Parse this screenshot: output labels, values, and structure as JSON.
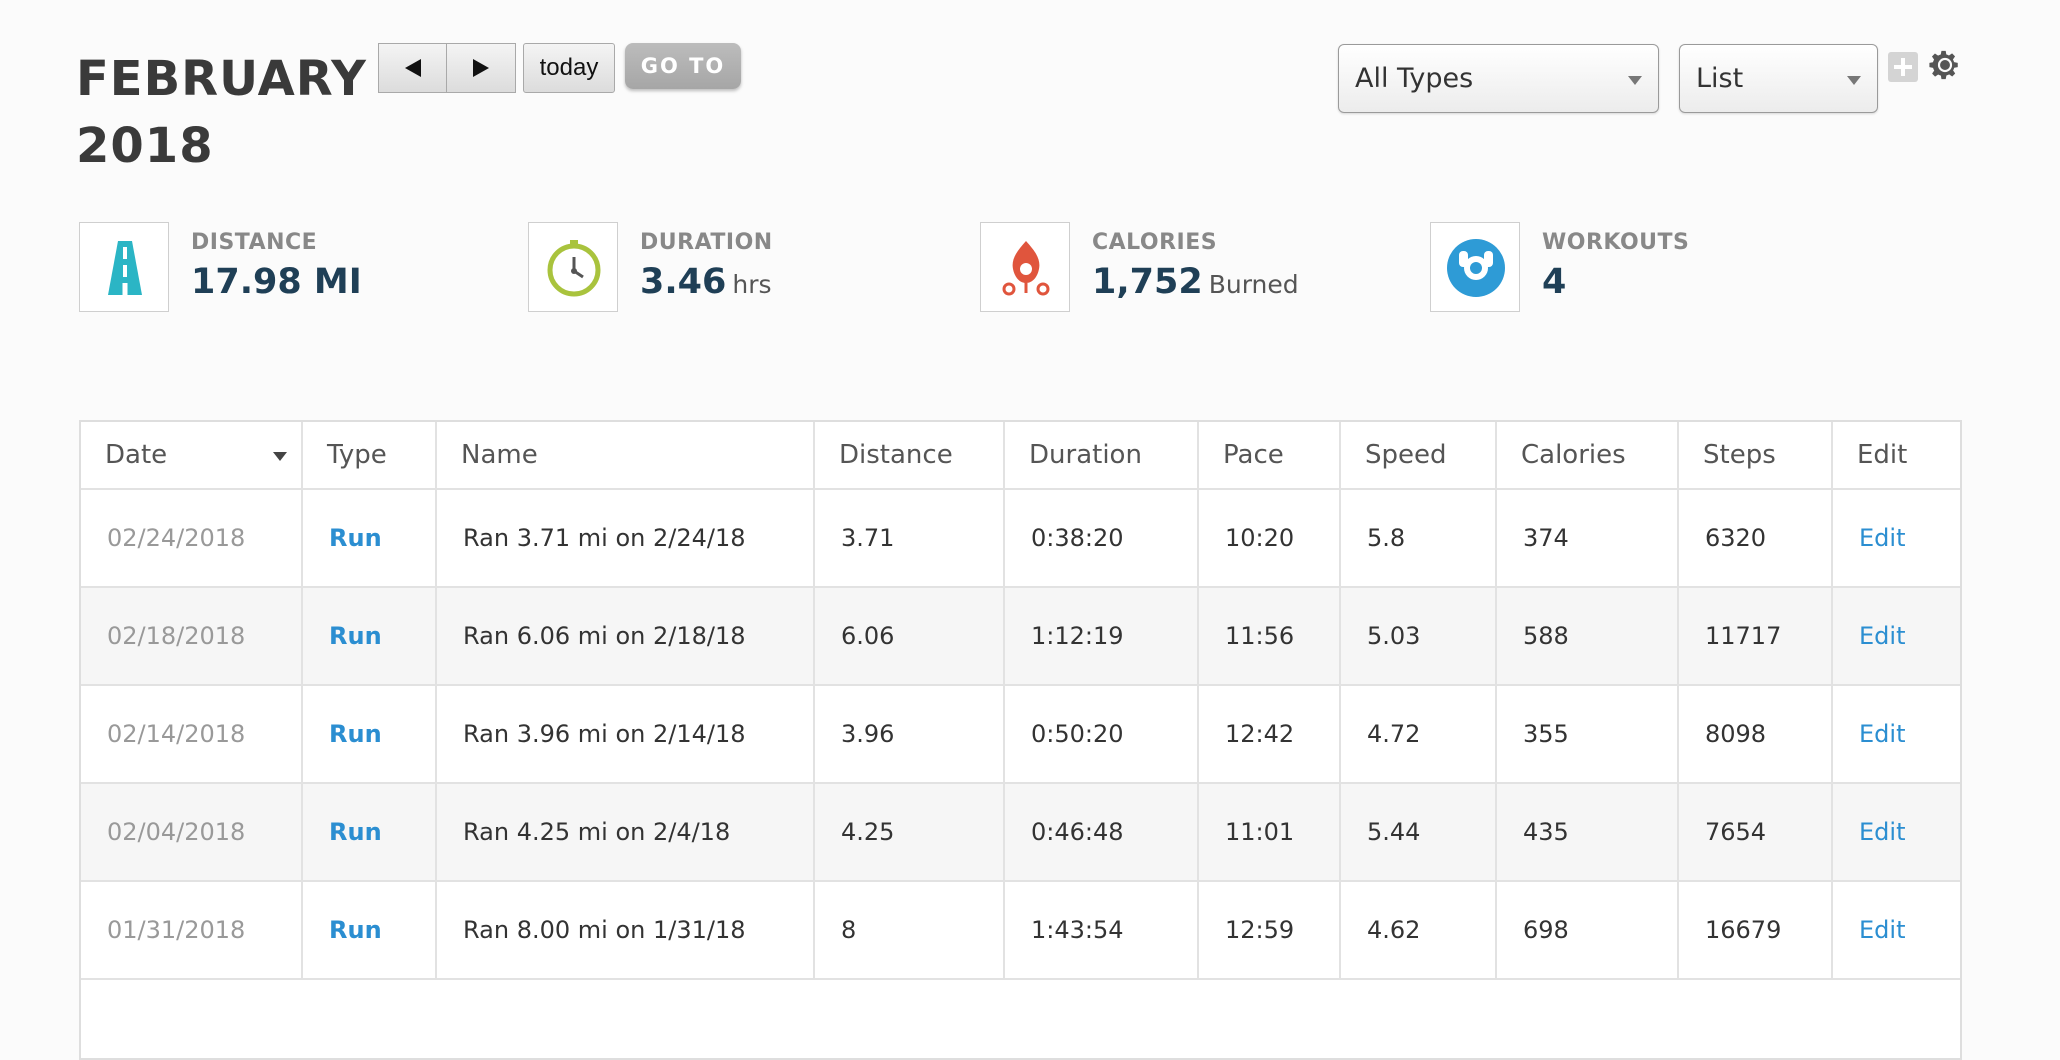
{
  "header": {
    "month": "FEBRUARY",
    "year": "2018",
    "today_label": "today",
    "goto_label": "GO TO",
    "type_filter": "All Types",
    "view_select": "List"
  },
  "stats": [
    {
      "label": "DISTANCE",
      "value": "17.98 MI",
      "unit": "",
      "icon": "road-icon",
      "color": "#2bb5c5"
    },
    {
      "label": "DURATION",
      "value": "3.46",
      "unit": "hrs",
      "icon": "stopwatch-icon",
      "color": "#a9c33d"
    },
    {
      "label": "CALORIES",
      "value": "1,752",
      "unit": "Burned",
      "icon": "flame-icon",
      "color": "#e0553d"
    },
    {
      "label": "WORKOUTS",
      "value": "4",
      "unit": "",
      "icon": "workout-icon",
      "color": "#2e9bd6"
    }
  ],
  "table": {
    "columns": [
      "Date",
      "Type",
      "Name",
      "Distance",
      "Duration",
      "Pace",
      "Speed",
      "Calories",
      "Steps",
      "Edit"
    ],
    "rows": [
      [
        "02/24/2018",
        "Run",
        "Ran 3.71 mi on 2/24/18",
        "3.71",
        "0:38:20",
        "10:20",
        "5.8",
        "374",
        "6320",
        "Edit"
      ],
      [
        "02/18/2018",
        "Run",
        "Ran 6.06 mi on 2/18/18",
        "6.06",
        "1:12:19",
        "11:56",
        "5.03",
        "588",
        "11717",
        "Edit"
      ],
      [
        "02/14/2018",
        "Run",
        "Ran 3.96 mi on 2/14/18",
        "3.96",
        "0:50:20",
        "12:42",
        "4.72",
        "355",
        "8098",
        "Edit"
      ],
      [
        "02/04/2018",
        "Run",
        "Ran 4.25 mi on 2/4/18",
        "4.25",
        "0:46:48",
        "11:01",
        "5.44",
        "435",
        "7654",
        "Edit"
      ],
      [
        "01/31/2018",
        "Run",
        "Ran 8.00 mi on 1/31/18",
        "8",
        "1:43:54",
        "12:59",
        "4.62",
        "698",
        "16679",
        "Edit"
      ]
    ]
  }
}
